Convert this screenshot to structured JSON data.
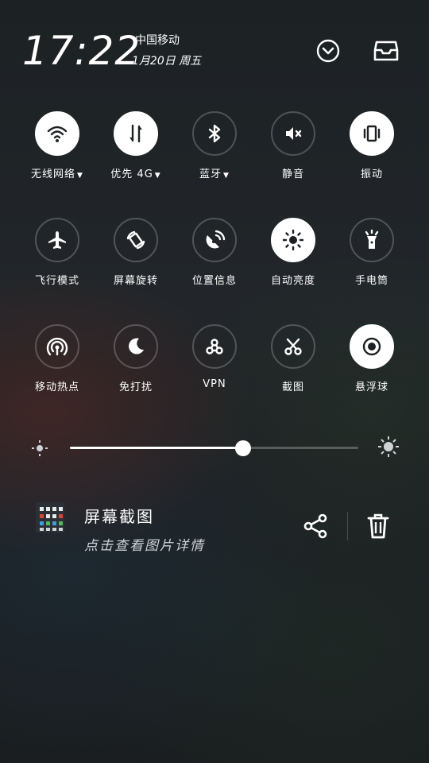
{
  "status": {
    "time": "17:22",
    "carrier": "中国移动",
    "date": "1月20日 周五"
  },
  "tiles": [
    {
      "label": "无线网络",
      "icon": "wifi-icon",
      "on": true,
      "caret": true
    },
    {
      "label": "优先 4G",
      "icon": "data-transfer-icon",
      "on": true,
      "caret": true
    },
    {
      "label": "蓝牙",
      "icon": "bluetooth-icon",
      "on": false,
      "caret": true
    },
    {
      "label": "静音",
      "icon": "mute-icon",
      "on": false,
      "caret": false
    },
    {
      "label": "振动",
      "icon": "vibrate-icon",
      "on": true,
      "caret": false
    },
    {
      "label": "飞行模式",
      "icon": "airplane-icon",
      "on": false,
      "caret": false
    },
    {
      "label": "屏幕旋转",
      "icon": "rotate-icon",
      "on": false,
      "caret": false
    },
    {
      "label": "位置信息",
      "icon": "location-icon",
      "on": false,
      "caret": false
    },
    {
      "label": "自动亮度",
      "icon": "auto-brightness-icon",
      "on": true,
      "caret": false
    },
    {
      "label": "手电筒",
      "icon": "flashlight-icon",
      "on": false,
      "caret": false
    },
    {
      "label": "移动热点",
      "icon": "hotspot-icon",
      "on": false,
      "caret": false
    },
    {
      "label": "免打扰",
      "icon": "moon-icon",
      "on": false,
      "caret": false
    },
    {
      "label": "VPN",
      "icon": "vpn-icon",
      "on": false,
      "caret": false
    },
    {
      "label": "截图",
      "icon": "scissors-icon",
      "on": false,
      "caret": false
    },
    {
      "label": "悬浮球",
      "icon": "floating-ball-icon",
      "on": true,
      "caret": false
    }
  ],
  "brightness": {
    "level": 0.6
  },
  "notification": {
    "title": "屏幕截图",
    "subtitle": "点击查看图片详情"
  },
  "colors": {
    "icon_on": "#1d2124",
    "icon_off": "#ffffff"
  }
}
